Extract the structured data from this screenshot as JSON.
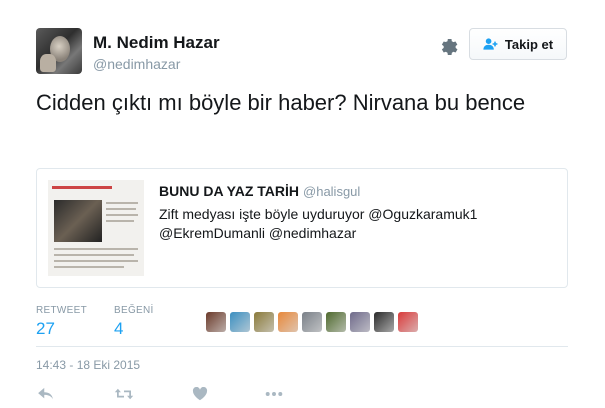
{
  "author": {
    "name": "M. Nedim Hazar",
    "handle": "@nedimhazar"
  },
  "follow_button": {
    "label": "Takip et"
  },
  "tweet": {
    "text": "Cidden çıktı mı böyle bir haber? Nirvana bu bence"
  },
  "quoted_tweet": {
    "name": "BUNU DA YAZ TARİH",
    "handle": "@halisgul",
    "text": "Zift medyası işte böyle uyduruyor @Oguzkaramuk1 @EkremDumanli @nedimhazar"
  },
  "stats": {
    "retweet_label": "RETWEET",
    "retweet_count": "27",
    "likes_label": "BEĞENİ",
    "likes_count": "4"
  },
  "likers": [
    {
      "icon": "liker-avatar-1",
      "color": "#6b3a2a"
    },
    {
      "icon": "liker-avatar-2",
      "color": "#3b8fc0"
    },
    {
      "icon": "liker-avatar-3",
      "color": "#8a7a3a"
    },
    {
      "icon": "liker-avatar-4",
      "color": "#e8883a"
    },
    {
      "icon": "liker-avatar-5",
      "color": "#7a8088"
    },
    {
      "icon": "liker-avatar-6",
      "color": "#4f6a2e"
    },
    {
      "icon": "liker-avatar-7",
      "color": "#6e6a8a"
    },
    {
      "icon": "liker-avatar-8",
      "color": "#2a2a2a"
    },
    {
      "icon": "liker-avatar-9",
      "color": "#d93a3a"
    }
  ],
  "timestamp": "14:43 - 18 Eki 2015",
  "colors": {
    "accent": "#1da1f2",
    "muted": "#8899a6",
    "text": "#14171a",
    "border": "#e1e8ed"
  }
}
